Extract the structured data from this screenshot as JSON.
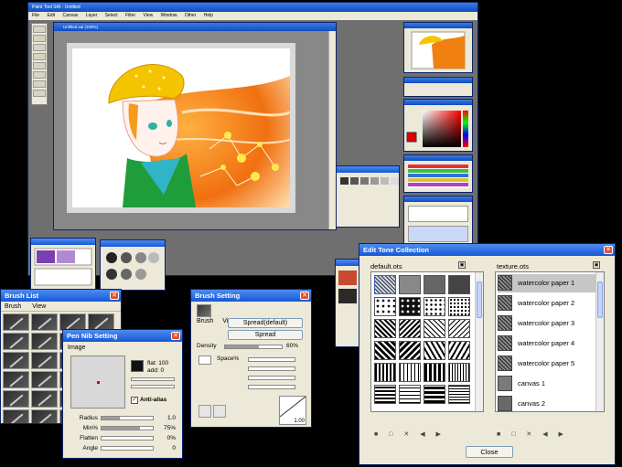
{
  "app": {
    "title": "Paint Tool SAI - Untitled",
    "menu": [
      "File",
      "Edit",
      "Canvas",
      "Layer",
      "Select",
      "Filter",
      "View",
      "Window",
      "Other",
      "Help"
    ],
    "canvas_title": "Untitled.sai  (100%)"
  },
  "brush_list": {
    "title": "Brush List",
    "menu": [
      "Brush",
      "View"
    ]
  },
  "pen_nib": {
    "title": "Pen Nib Setting",
    "image_label": "Image",
    "flat_label": "flat: 100",
    "add_label": "add: 0",
    "anti_alias_label": "Anti-alias",
    "sliders": [
      {
        "label": "Radius",
        "value": "1.0",
        "fraction": 0.35
      },
      {
        "label": "Min%",
        "value": "75%",
        "fraction": 0.75
      },
      {
        "label": "Flatten",
        "value": "0%",
        "fraction": 0.0
      },
      {
        "label": "Angle",
        "value": "0",
        "fraction": 0.0
      }
    ]
  },
  "brush_setting": {
    "title": "Brush Setting",
    "menu": [
      "Brush",
      "View"
    ],
    "dropdown": "Spread(default)",
    "button": "Spread",
    "density_label": "Density",
    "density_value": "60%",
    "density_fraction": 0.6,
    "space_label": "Space%",
    "curve_value": "1.00"
  },
  "tone": {
    "title": "Edit Tone Collection",
    "left_file": "default.ots",
    "right_file": "texture.ots",
    "textures": [
      "watercolor paper 1",
      "watercolor paper 2",
      "watercolor paper 3",
      "watercolor paper 4",
      "watercolor paper 5",
      "canvas 1",
      "canvas 2"
    ],
    "selected_index": 0,
    "close_label": "Close"
  },
  "colors": {
    "titlebar": "#1558d6",
    "panel_bg": "#ece9d8",
    "workspace": "#6f6f6f"
  }
}
